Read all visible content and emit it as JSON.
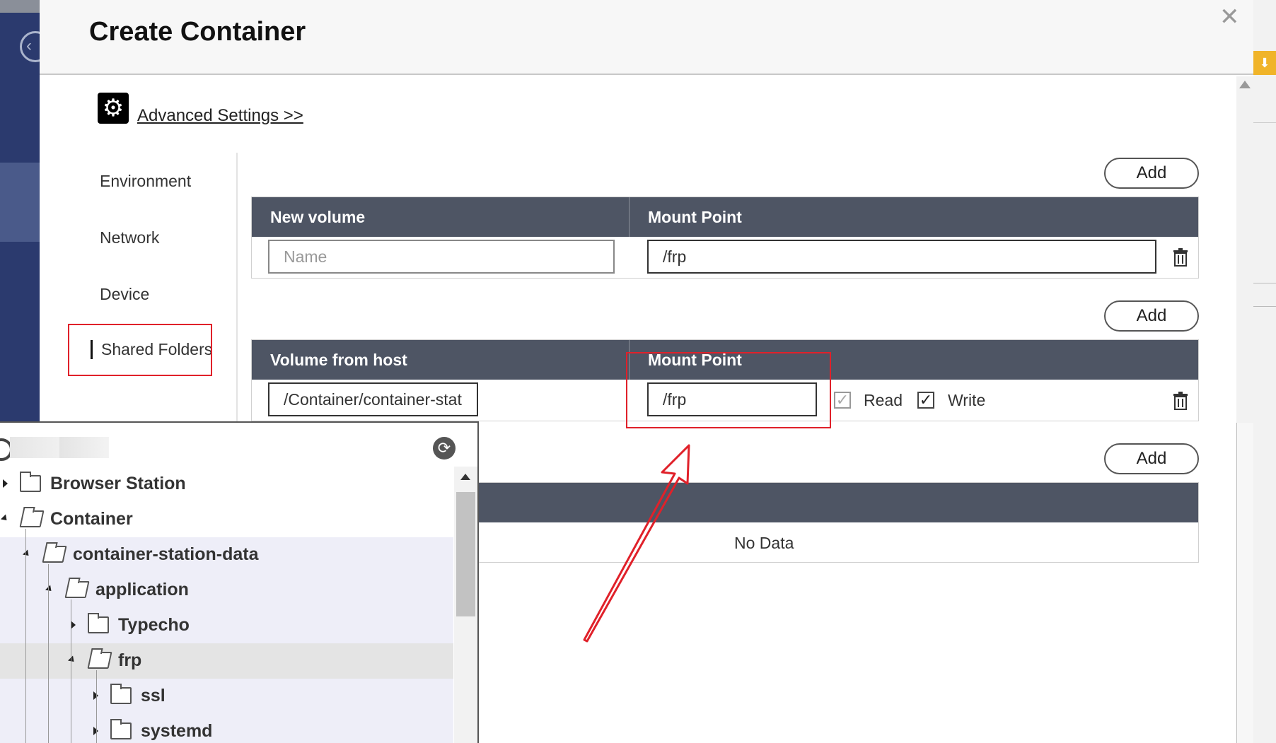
{
  "modal": {
    "title": "Create Container",
    "close_icon": "close-icon"
  },
  "advanced": {
    "link_label": "Advanced Settings >>"
  },
  "sidenav": {
    "items": [
      {
        "label": "Environment"
      },
      {
        "label": "Network"
      },
      {
        "label": "Device"
      },
      {
        "label": "Shared Folders"
      }
    ]
  },
  "volumes_table": {
    "add_label": "Add",
    "col1": "New volume",
    "col2": "Mount Point",
    "name_placeholder": "Name",
    "mount_value": "/frp"
  },
  "host_table": {
    "add_label": "Add",
    "col1": "Volume from host",
    "col2": "Mount Point",
    "host_path": "/Container/container-stat",
    "mount_value": "/frp",
    "read_label": "Read",
    "write_label": "Write",
    "read_checked": true,
    "write_checked": true
  },
  "third_table": {
    "add_label": "Add",
    "empty_text": "No Data"
  },
  "tree": {
    "rows": [
      {
        "label": "Browser Station"
      },
      {
        "label": "Container"
      },
      {
        "label": "container-station-data"
      },
      {
        "label": "application"
      },
      {
        "label": "Typecho"
      },
      {
        "label": "frp"
      },
      {
        "label": "ssl"
      },
      {
        "label": "systemd"
      }
    ]
  },
  "colors": {
    "header_bg": "#4e5564",
    "highlight_red": "#e0212a"
  }
}
